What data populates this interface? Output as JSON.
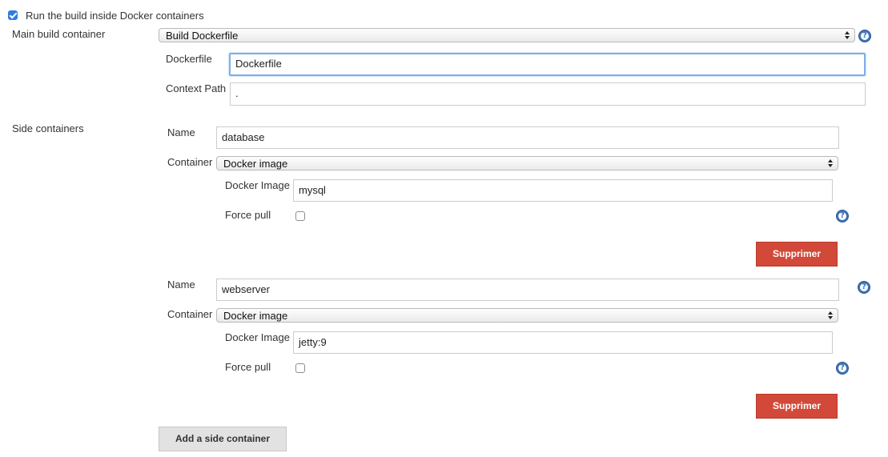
{
  "docker_section": {
    "checkbox_label": "Run the build inside Docker containers",
    "checked": true
  },
  "main_container": {
    "label": "Main build container",
    "selected": "Build Dockerfile",
    "dockerfile_label": "Dockerfile",
    "dockerfile_value": "Dockerfile",
    "context_label": "Context Path",
    "context_value": "."
  },
  "side_containers": {
    "label": "Side containers",
    "items": [
      {
        "name_label": "Name",
        "name_value": "database",
        "container_label": "Container",
        "container_selected": "Docker image",
        "image_label": "Docker Image",
        "image_value": "mysql",
        "force_pull_label": "Force pull",
        "force_pull": false,
        "delete_label": "Supprimer"
      },
      {
        "name_label": "Name",
        "name_value": "webserver",
        "container_label": "Container",
        "container_selected": "Docker image",
        "image_label": "Docker Image",
        "image_value": "jetty:9",
        "force_pull_label": "Force pull",
        "force_pull": false,
        "delete_label": "Supprimer"
      }
    ],
    "add_label": "Add a side container"
  },
  "colors": {
    "accent": "#2f7de1",
    "danger": "#d24939",
    "help": "#3f74b8"
  },
  "icons": [
    "help-icon",
    "select-arrows-icon",
    "checkbox-icon"
  ]
}
